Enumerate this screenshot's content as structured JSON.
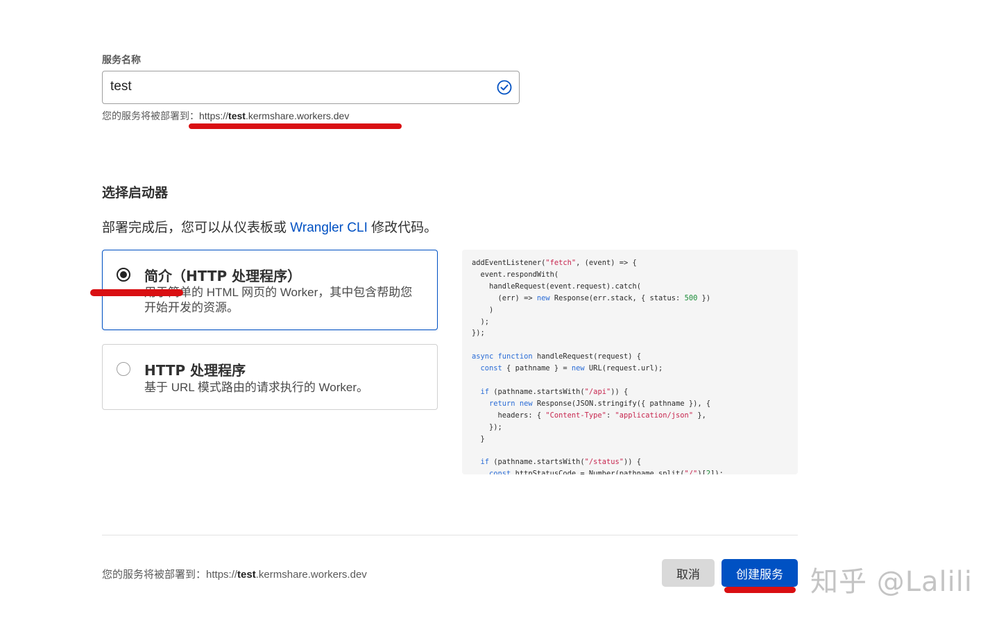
{
  "service_name": {
    "label": "服务名称",
    "value": "test",
    "valid_icon": "check-circle-icon"
  },
  "deploy_info": {
    "prefix": "您的服务将被部署到：",
    "url_scheme": "https://",
    "url_sub": "test",
    "url_rest": ".kermshare.workers.dev"
  },
  "starter": {
    "title": "选择启动器",
    "desc_before": "部署完成后，您可以从仪表板或 ",
    "desc_link": "Wrangler CLI",
    "desc_after": " 修改代码。",
    "options": [
      {
        "title": "简介（HTTP 处理程序）",
        "desc": "用于简单的 HTML 网页的 Worker，其中包含帮助您开始开发的资源。",
        "selected": true
      },
      {
        "title": "HTTP 处理程序",
        "desc": "基于 URL 模式路由的请求执行的 Worker。",
        "selected": false
      }
    ]
  },
  "code_preview": {
    "lines": [
      "addEventListener(\"fetch\", (event) => {",
      "  event.respondWith(",
      "    handleRequest(event.request).catch(",
      "      (err) => new Response(err.stack, { status: 500 })",
      "    )",
      "  );",
      "});",
      "",
      "async function handleRequest(request) {",
      "  const { pathname } = new URL(request.url);",
      "",
      "  if (pathname.startsWith(\"/api\")) {",
      "    return new Response(JSON.stringify({ pathname }), {",
      "      headers: { \"Content-Type\": \"application/json\" },",
      "    });",
      "  }",
      "",
      "  if (pathname.startsWith(\"/status\")) {",
      "    const httpStatusCode = Number(pathname.split(\"/\")[2]);"
    ]
  },
  "footer": {
    "prefix": "您的服务将被部署到：",
    "url_scheme": "https://",
    "url_sub": "test",
    "url_rest": ".kermshare.workers.dev",
    "cancel_label": "取消",
    "create_label": "创建服务"
  },
  "watermark": "知乎 @Lalili",
  "colors": {
    "accent": "#0051c3",
    "annotation_red": "#d90f12"
  }
}
